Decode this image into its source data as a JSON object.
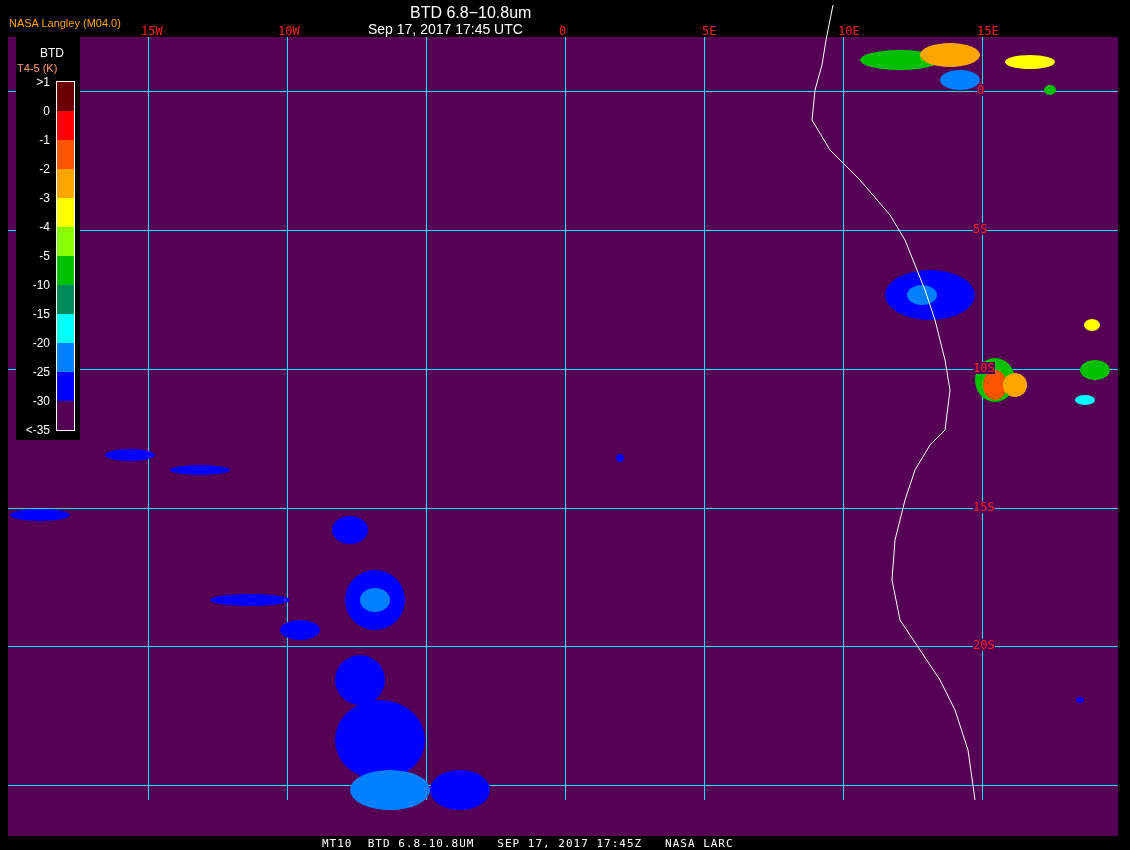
{
  "header": {
    "source": "NASA Langley (M04.0)",
    "product": "BTD 6.8−10.8um",
    "time": "Sep 17, 2017 17:45 UTC"
  },
  "longitude_labels": [
    "15W",
    "10W",
    "0",
    "5E",
    "10E",
    "15E"
  ],
  "latitude_labels": [
    "0",
    "5S",
    "10S",
    "15S",
    "20S"
  ],
  "legend": {
    "title": "BTD",
    "unit": "T4-5 (K)",
    "labels": [
      ">1",
      "0",
      "-1",
      "-2",
      "-3",
      "-4",
      "-5",
      "-10",
      "-15",
      "-20",
      "-25",
      "-30",
      "<-35"
    ],
    "bins": [
      {
        "color": "#6b0000"
      },
      {
        "color": "#ff0000"
      },
      {
        "color": "#ff5500"
      },
      {
        "color": "#ffa500"
      },
      {
        "color": "#ffff00"
      },
      {
        "color": "#88ff00"
      },
      {
        "color": "#00c000"
      },
      {
        "color": "#008c5a"
      },
      {
        "color": "#00ffff"
      },
      {
        "color": "#0080ff"
      },
      {
        "color": "#0000ff"
      },
      {
        "color": "#550055"
      }
    ]
  },
  "footer": "MT10  BTD 6.8-10.8UM   SEP 17, 2017 17:45Z   NASA LARC"
}
